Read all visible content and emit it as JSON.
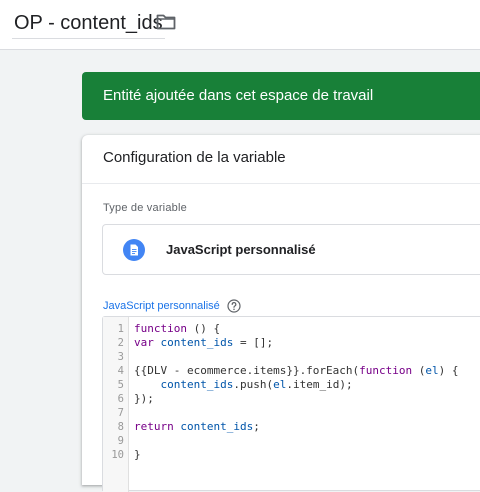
{
  "header": {
    "title": "OP - content_ids",
    "folder_icon": "folder-icon"
  },
  "toast": {
    "message": "Entité ajoutée dans cet espace de travail",
    "color": "#188038"
  },
  "card": {
    "title": "Configuration de la variable",
    "type_label": "Type de variable",
    "type_value": "JavaScript personnalisé",
    "type_icon": "document-icon",
    "js_label": "JavaScript personnalisé",
    "help_icon": "help-icon",
    "editor": {
      "line_numbers": [
        "1",
        "2",
        "3",
        "4",
        "5",
        "6",
        "7",
        "8",
        "9",
        "10"
      ],
      "lines": [
        {
          "t": [
            {
              "s": "function",
              "c": "kw"
            },
            {
              "s": " () {"
            }
          ]
        },
        {
          "t": [
            {
              "s": "var",
              "c": "kw"
            },
            {
              "s": " "
            },
            {
              "s": "content_ids",
              "c": "var"
            },
            {
              "s": " = [];"
            }
          ]
        },
        {
          "t": [
            {
              "s": ""
            }
          ]
        },
        {
          "t": [
            {
              "s": "{{DLV - ecommerce.items}}.forEach("
            },
            {
              "s": "function",
              "c": "kw"
            },
            {
              "s": " ("
            },
            {
              "s": "el",
              "c": "var"
            },
            {
              "s": ") {"
            }
          ]
        },
        {
          "t": [
            {
              "s": "    "
            },
            {
              "s": "content_ids",
              "c": "var"
            },
            {
              "s": ".push("
            },
            {
              "s": "el",
              "c": "var"
            },
            {
              "s": ".item_id);"
            }
          ]
        },
        {
          "t": [
            {
              "s": "});"
            }
          ]
        },
        {
          "t": [
            {
              "s": ""
            }
          ]
        },
        {
          "t": [
            {
              "s": "return",
              "c": "kw"
            },
            {
              "s": " "
            },
            {
              "s": "content_ids",
              "c": "var"
            },
            {
              "s": ";"
            }
          ]
        },
        {
          "t": [
            {
              "s": ""
            }
          ]
        },
        {
          "t": [
            {
              "s": "}"
            }
          ]
        }
      ]
    }
  },
  "colors": {
    "accent": "#1a73e8",
    "keyword": "#770088",
    "variable": "#0055aa"
  }
}
